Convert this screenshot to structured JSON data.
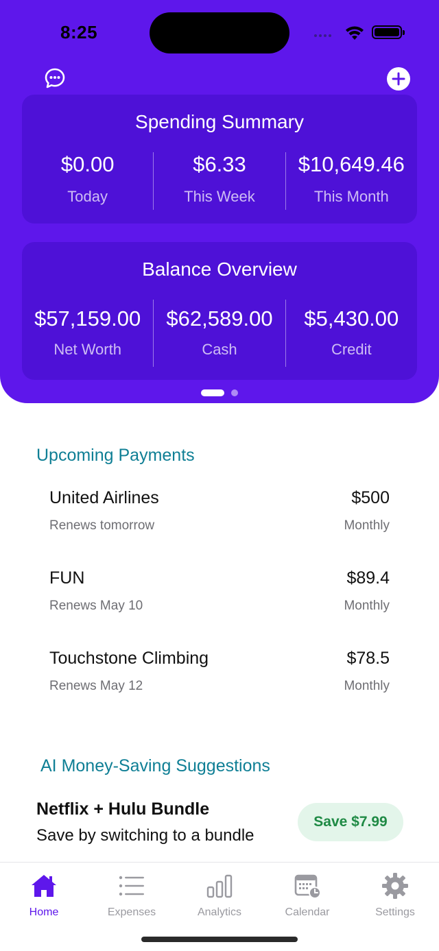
{
  "status_bar": {
    "time": "8:25"
  },
  "header": {
    "chat_icon": "chat-bubble-icon",
    "add_icon": "plus-icon"
  },
  "spending_summary": {
    "title": "Spending Summary",
    "stats": [
      {
        "value": "$0.00",
        "label": "Today"
      },
      {
        "value": "$6.33",
        "label": "This Week"
      },
      {
        "value": "$10,649.46",
        "label": "This Month"
      }
    ]
  },
  "balance_overview": {
    "title": "Balance Overview",
    "stats": [
      {
        "value": "$57,159.00",
        "label": "Net Worth"
      },
      {
        "value": "$62,589.00",
        "label": "Cash"
      },
      {
        "value": "$5,430.00",
        "label": "Credit"
      }
    ]
  },
  "page_indicator": {
    "pages": 2,
    "current": 1
  },
  "upcoming_payments": {
    "title": "Upcoming Payments",
    "items": [
      {
        "name": "United Airlines",
        "amount": "$500",
        "renews": "Renews tomorrow",
        "frequency": "Monthly"
      },
      {
        "name": "FUN",
        "amount": "$89.4",
        "renews": "Renews May 10",
        "frequency": "Monthly"
      },
      {
        "name": "Touchstone Climbing",
        "amount": "$78.5",
        "renews": "Renews May 12",
        "frequency": "Monthly"
      }
    ]
  },
  "ai_suggestions": {
    "title": "AI Money-Saving Suggestions",
    "items": [
      {
        "name": "Netflix + Hulu Bundle",
        "description": "Save by switching to a bundle",
        "save_label": "Save $7.99"
      }
    ]
  },
  "tab_bar": {
    "tabs": [
      {
        "label": "Home",
        "icon": "home-icon",
        "active": true
      },
      {
        "label": "Expenses",
        "icon": "list-icon",
        "active": false
      },
      {
        "label": "Analytics",
        "icon": "bar-chart-icon",
        "active": false
      },
      {
        "label": "Calendar",
        "icon": "calendar-icon",
        "active": false
      },
      {
        "label": "Settings",
        "icon": "gear-icon",
        "active": false
      }
    ]
  },
  "colors": {
    "brand": "#5e17eb",
    "section_title": "#0f7f95",
    "save_green": "#1f8a45",
    "save_bg": "#e3f5ea"
  }
}
